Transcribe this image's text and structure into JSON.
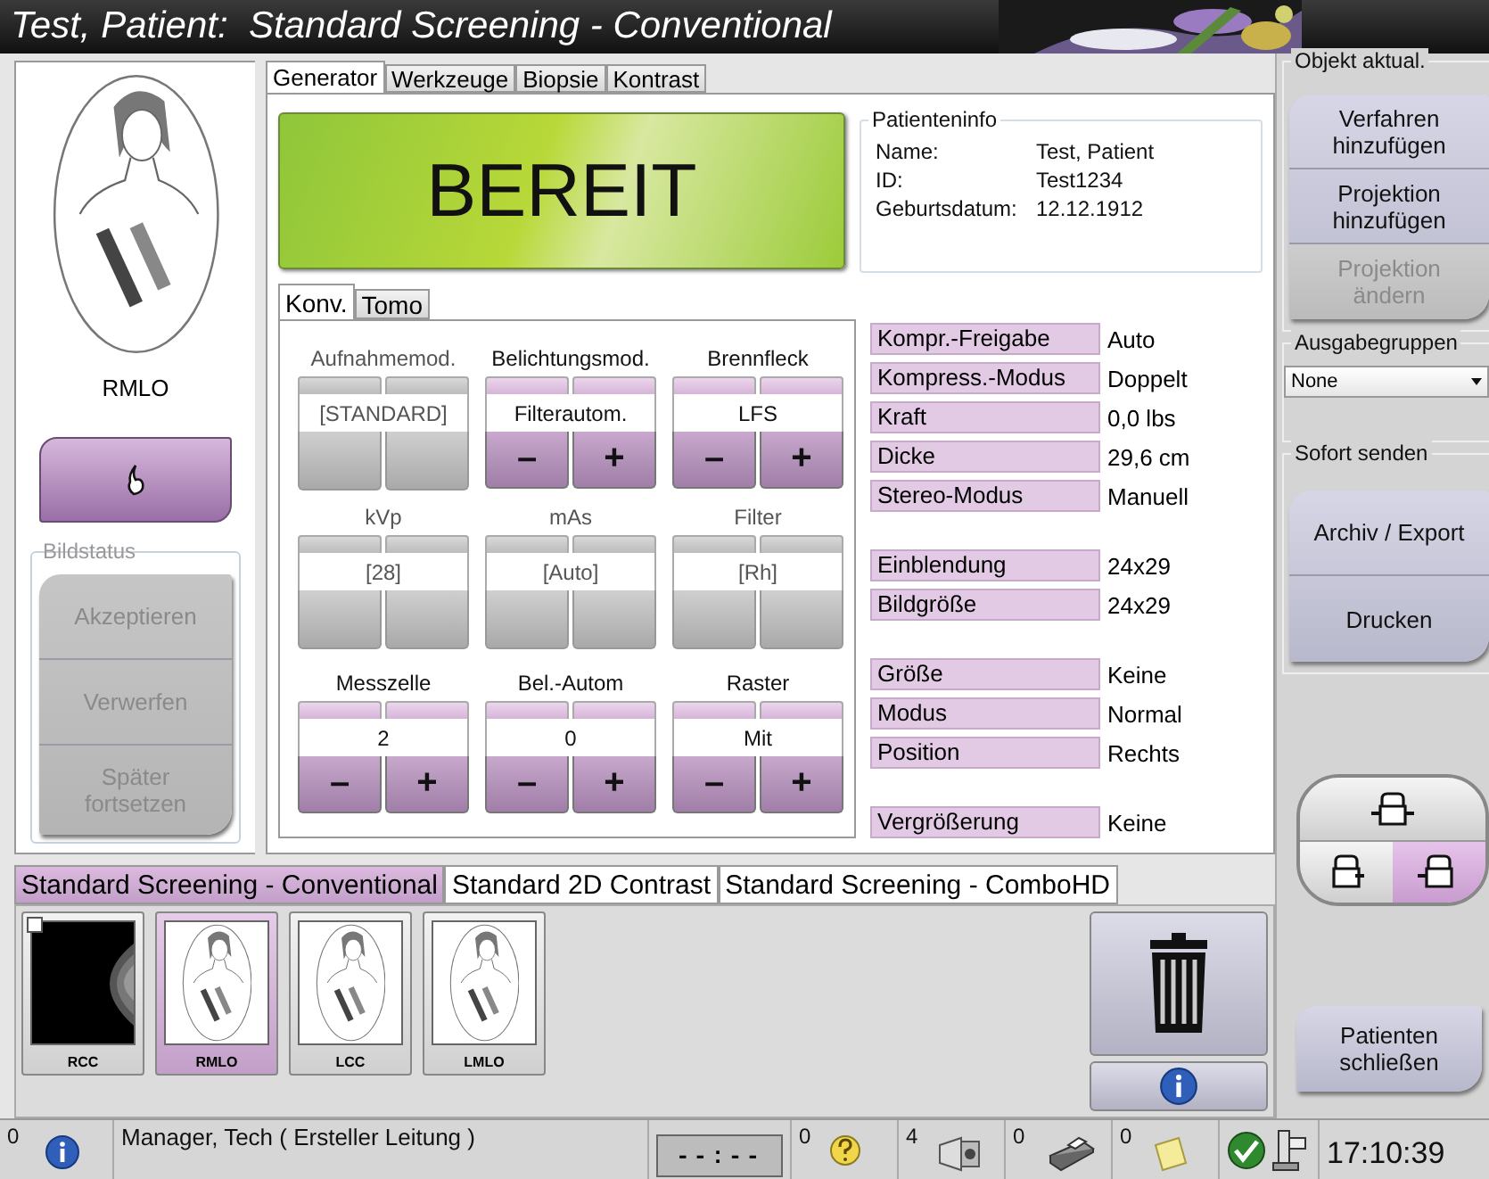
{
  "window": {
    "title": "Test, Patient:  Standard Screening - Conventional"
  },
  "view": {
    "label": "RMLO"
  },
  "image_status": {
    "title": "Bildstatus",
    "buttons": [
      {
        "label": "Akzeptieren",
        "disabled": true
      },
      {
        "label": "Verwerfen",
        "disabled": true
      },
      {
        "label": "Später fortsetzen",
        "disabled": true
      }
    ]
  },
  "generator_tabs": [
    {
      "label": "Generator",
      "selected": true
    },
    {
      "label": "Werkzeuge",
      "selected": false
    },
    {
      "label": "Biopsie",
      "selected": false
    },
    {
      "label": "Kontrast",
      "selected": false
    }
  ],
  "status": "BEREIT",
  "patient_info": {
    "title": "Patienteninfo",
    "rows": [
      {
        "label": "Name:",
        "value": "Test, Patient"
      },
      {
        "label": "ID:",
        "value": "Test1234"
      },
      {
        "label": "Geburtsdatum:",
        "value": "12.12.1912"
      }
    ]
  },
  "mode_tabs": [
    {
      "label": "Konv.",
      "selected": true
    },
    {
      "label": "Tomo",
      "selected": false
    }
  ],
  "controls": [
    {
      "label": "Aufnahmemod.",
      "value": "[STANDARD]",
      "disabled": true
    },
    {
      "label": "Belichtungsmod.",
      "value": "Filterautom.",
      "disabled": false,
      "minus": "–",
      "plus": "+"
    },
    {
      "label": "Brennfleck",
      "value": "LFS",
      "disabled": false,
      "minus": "–",
      "plus": "+"
    },
    {
      "label": "kVp",
      "value": "[28]",
      "disabled": true
    },
    {
      "label": "mAs",
      "value": "[Auto]",
      "disabled": true
    },
    {
      "label": "Filter",
      "value": "[Rh]",
      "disabled": true
    },
    {
      "label": "Messzelle",
      "value": "2",
      "disabled": false,
      "minus": "–",
      "plus": "+"
    },
    {
      "label": "Bel.-Autom",
      "value": "0",
      "disabled": false,
      "minus": "–",
      "plus": "+"
    },
    {
      "label": "Raster",
      "value": "Mit",
      "disabled": false,
      "minus": "–",
      "plus": "+"
    }
  ],
  "settings_groups": [
    [
      {
        "label": "Kompr.-Freigabe",
        "value": "Auto"
      },
      {
        "label": "Kompress.-Modus",
        "value": "Doppelt"
      },
      {
        "label": "Kraft",
        "value": "0,0 lbs"
      },
      {
        "label": "Dicke",
        "value": "29,6 cm"
      },
      {
        "label": "Stereo-Modus",
        "value": "Manuell"
      }
    ],
    [
      {
        "label": "Einblendung",
        "value": "24x29"
      },
      {
        "label": "Bildgröße",
        "value": "24x29"
      }
    ],
    [
      {
        "label": "Größe",
        "value": "Keine"
      },
      {
        "label": "Modus",
        "value": "Normal"
      },
      {
        "label": "Position",
        "value": "Rechts"
      }
    ],
    [
      {
        "label": "Vergrößerung",
        "value": "Keine"
      }
    ]
  ],
  "procedure_tabs": [
    {
      "label": "Standard Screening - Conventional",
      "selected": true
    },
    {
      "label": "Standard 2D Contrast",
      "selected": false
    },
    {
      "label": "Standard Screening - ComboHD",
      "selected": false
    }
  ],
  "thumbnails": [
    {
      "label": "RCC",
      "selected": false,
      "checked": false
    },
    {
      "label": "RMLO",
      "kind": "figure",
      "selected": true
    },
    {
      "label": "LCC",
      "kind": "figure",
      "selected": false
    },
    {
      "label": "LMLO",
      "kind": "figure",
      "selected": false
    }
  ],
  "update_object": {
    "title": "Objekt aktual.",
    "buttons": [
      {
        "label": "Verfahren hinzufügen",
        "disabled": false
      },
      {
        "label": "Projektion hinzufügen",
        "disabled": false
      },
      {
        "label": "Projektion ändern",
        "disabled": true
      }
    ]
  },
  "output_groups": {
    "title": "Ausgabegruppen",
    "value": "None"
  },
  "send_now": {
    "title": "Sofort senden",
    "buttons": [
      "Archiv  / Export",
      "Drucken"
    ]
  },
  "paddle_modes": [
    {
      "kind": "center",
      "selected": false
    },
    {
      "kind": "left",
      "selected": false
    },
    {
      "kind": "right",
      "selected": true
    }
  ],
  "close_button": "Patienten schließen",
  "status_bar": {
    "alerts": "0",
    "user": "Manager, Tech ( Ersteller Leitung )",
    "timer": "--:--",
    "queues": [
      {
        "kind": "help",
        "count": "0"
      },
      {
        "kind": "images",
        "count": "4"
      },
      {
        "kind": "print",
        "count": "0"
      },
      {
        "kind": "notes",
        "count": "0"
      }
    ],
    "time": "17:10:39"
  }
}
